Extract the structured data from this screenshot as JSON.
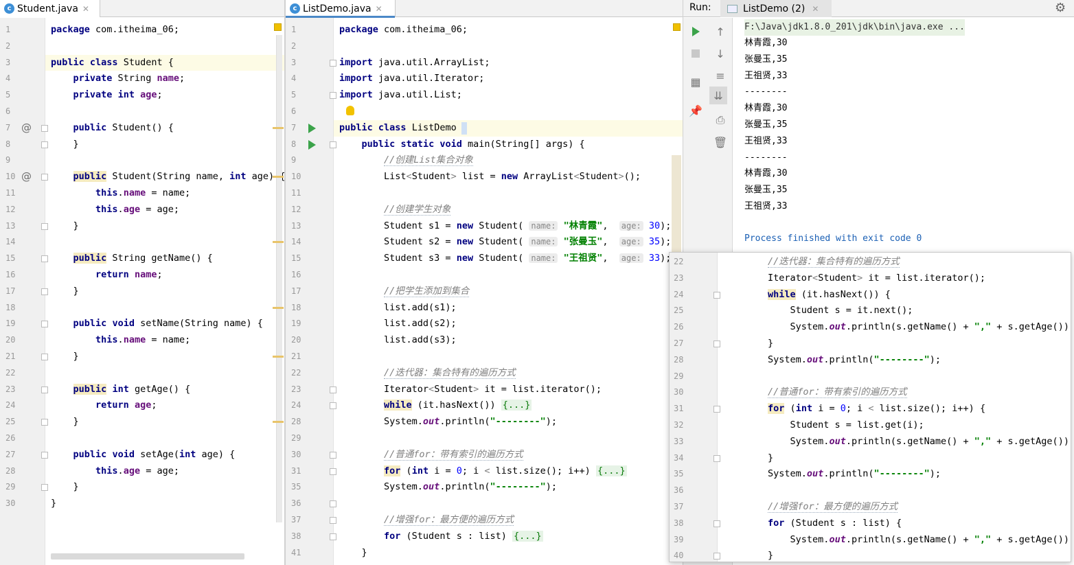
{
  "tabs": {
    "student": "Student.java",
    "listdemo": "ListDemo.java"
  },
  "run": {
    "label": "Run:",
    "tab": "ListDemo (2)",
    "cmd": "F:\\Java\\jdk1.8.0_201\\jdk\\bin\\java.exe ...",
    "output": [
      "林青霞,30",
      "张曼玉,35",
      "王祖贤,33",
      "--------",
      "林青霞,30",
      "张曼玉,35",
      "王祖贤,33",
      "--------",
      "林青霞,30",
      "张曼玉,35",
      "王祖贤,33"
    ],
    "finished": "Process finished with exit code 0"
  },
  "student": {
    "lines": [
      {
        "n": "1",
        "t": "package com.itheima_06;"
      },
      {
        "n": "2",
        "t": ""
      },
      {
        "n": "3",
        "t": "public class Student {"
      },
      {
        "n": "4",
        "t": "    private String name;"
      },
      {
        "n": "5",
        "t": "    private int age;"
      },
      {
        "n": "6",
        "t": ""
      },
      {
        "n": "7",
        "t": "    public Student() {"
      },
      {
        "n": "8",
        "t": "    }"
      },
      {
        "n": "9",
        "t": ""
      },
      {
        "n": "10",
        "t": "    public Student(String name, int age) {"
      },
      {
        "n": "11",
        "t": "        this.name = name;"
      },
      {
        "n": "12",
        "t": "        this.age = age;"
      },
      {
        "n": "13",
        "t": "    }"
      },
      {
        "n": "14",
        "t": ""
      },
      {
        "n": "15",
        "t": "    public String getName() {"
      },
      {
        "n": "16",
        "t": "        return name;"
      },
      {
        "n": "17",
        "t": "    }"
      },
      {
        "n": "18",
        "t": ""
      },
      {
        "n": "19",
        "t": "    public void setName(String name) {"
      },
      {
        "n": "20",
        "t": "        this.name = name;"
      },
      {
        "n": "21",
        "t": "    }"
      },
      {
        "n": "22",
        "t": ""
      },
      {
        "n": "23",
        "t": "    public int getAge() {"
      },
      {
        "n": "24",
        "t": "        return age;"
      },
      {
        "n": "25",
        "t": "    }"
      },
      {
        "n": "26",
        "t": ""
      },
      {
        "n": "27",
        "t": "    public void setAge(int age) {"
      },
      {
        "n": "28",
        "t": "        this.age = age;"
      },
      {
        "n": "29",
        "t": "    }"
      },
      {
        "n": "30",
        "t": "}"
      }
    ]
  },
  "listdemo": {
    "lines": [
      {
        "n": "1",
        "t": "package com.itheima_06;"
      },
      {
        "n": "2",
        "t": ""
      },
      {
        "n": "3",
        "t": "import java.util.ArrayList;"
      },
      {
        "n": "4",
        "t": "import java.util.Iterator;"
      },
      {
        "n": "5",
        "t": "import java.util.List;"
      },
      {
        "n": "6",
        "t": ""
      },
      {
        "n": "7",
        "t": "public class ListDemo {"
      },
      {
        "n": "8",
        "t": "    public static void main(String[] args) {"
      },
      {
        "n": "9",
        "t": "        //创建List集合对象"
      },
      {
        "n": "10",
        "t": "        List<Student> list = new ArrayList<Student>();"
      },
      {
        "n": "11",
        "t": ""
      },
      {
        "n": "12",
        "t": "        //创建学生对象"
      },
      {
        "n": "13",
        "t": "        Student s1 = new Student( name: \"林青霞\",  age: 30);"
      },
      {
        "n": "14",
        "t": "        Student s2 = new Student( name: \"张曼玉\",  age: 35);"
      },
      {
        "n": "15",
        "t": "        Student s3 = new Student( name: \"王祖贤\",  age: 33);"
      },
      {
        "n": "16",
        "t": ""
      },
      {
        "n": "17",
        "t": "        //把学生添加到集合"
      },
      {
        "n": "18",
        "t": "        list.add(s1);"
      },
      {
        "n": "19",
        "t": "        list.add(s2);"
      },
      {
        "n": "20",
        "t": "        list.add(s3);"
      },
      {
        "n": "21",
        "t": ""
      },
      {
        "n": "22",
        "t": "        //迭代器：集合特有的遍历方式"
      },
      {
        "n": "23",
        "t": "        Iterator<Student> it = list.iterator();"
      },
      {
        "n": "24",
        "t": "        while (it.hasNext()) {...}"
      },
      {
        "n": "28",
        "t": "        System.out.println(\"--------\");"
      },
      {
        "n": "29",
        "t": ""
      },
      {
        "n": "30",
        "t": "        //普通for：带有索引的遍历方式"
      },
      {
        "n": "31",
        "t": "        for (int i = 0; i < list.size(); i++) {...}"
      },
      {
        "n": "35",
        "t": "        System.out.println(\"--------\");"
      },
      {
        "n": "36",
        "t": ""
      },
      {
        "n": "37",
        "t": "        //增强for：最方便的遍历方式"
      },
      {
        "n": "38",
        "t": "        for (Student s : list) {...}"
      },
      {
        "n": "41",
        "t": "    }"
      }
    ]
  },
  "popup": {
    "lines": [
      {
        "n": "22",
        "t": "        //迭代器：集合特有的遍历方式"
      },
      {
        "n": "23",
        "t": "        Iterator<Student> it = list.iterator();"
      },
      {
        "n": "24",
        "t": "        while (it.hasNext()) {"
      },
      {
        "n": "25",
        "t": "            Student s = it.next();"
      },
      {
        "n": "26",
        "t": "            System.out.println(s.getName() + \",\" + s.getAge());"
      },
      {
        "n": "27",
        "t": "        }"
      },
      {
        "n": "28",
        "t": "        System.out.println(\"--------\");"
      },
      {
        "n": "29",
        "t": ""
      },
      {
        "n": "30",
        "t": "        //普通for：带有索引的遍历方式"
      },
      {
        "n": "31",
        "t": "        for (int i = 0; i < list.size(); i++) {"
      },
      {
        "n": "32",
        "t": "            Student s = list.get(i);"
      },
      {
        "n": "33",
        "t": "            System.out.println(s.getName() + \",\" + s.getAge());"
      },
      {
        "n": "34",
        "t": "        }"
      },
      {
        "n": "35",
        "t": "        System.out.println(\"--------\");"
      },
      {
        "n": "36",
        "t": ""
      },
      {
        "n": "37",
        "t": "        //增强for：最方便的遍历方式"
      },
      {
        "n": "38",
        "t": "        for (Student s : list) {"
      },
      {
        "n": "39",
        "t": "            System.out.println(s.getName() + \",\" + s.getAge());"
      },
      {
        "n": "40",
        "t": "        }"
      }
    ]
  },
  "icons": {
    "class_icon": "class-c-icon",
    "override_icon": "@",
    "run_icon": "run-play-icon",
    "settings_icon": "gear-icon"
  },
  "colors": {
    "keyword": "#000080",
    "field": "#660e7a",
    "comment": "#808080",
    "string": "#008000",
    "number": "#0000ff",
    "run_green": "#3ba34a",
    "output_blue": "#1a5fb4"
  }
}
